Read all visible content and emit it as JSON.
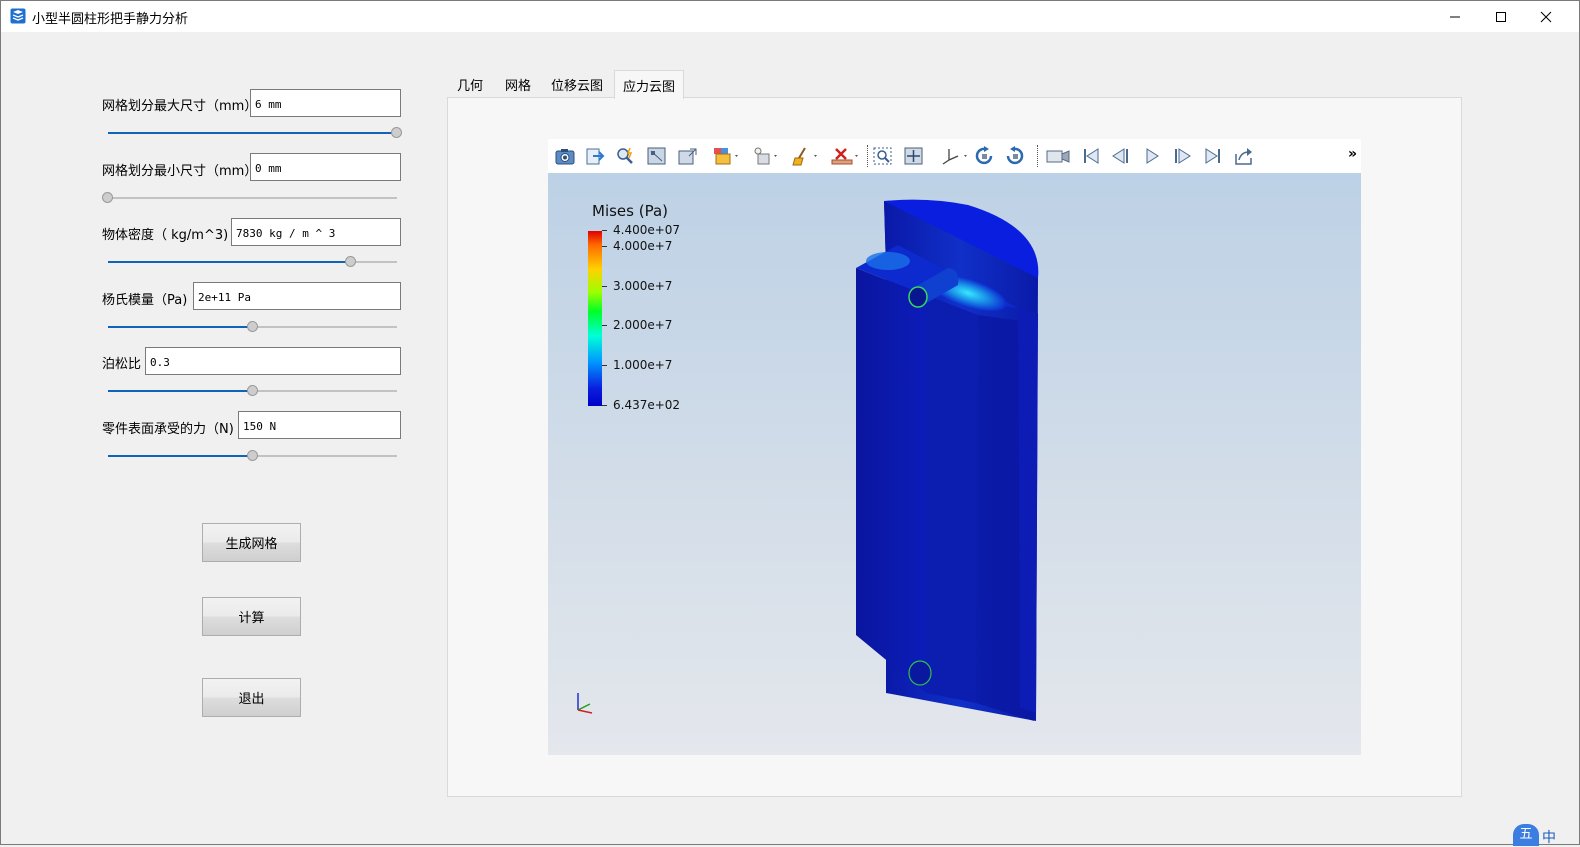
{
  "window": {
    "title": "小型半圆柱形把手静力分析",
    "minimize": "—",
    "maximize": "☐",
    "close": "✕"
  },
  "params": [
    {
      "label": "网格划分最大尺寸（mm）",
      "value": "6 mm",
      "slider": 1.0
    },
    {
      "label": "网格划分最小尺寸（mm）",
      "value": "0 mm",
      "slider": 0.0
    },
    {
      "label": "物体密度（ kg/m^3)",
      "value": "7830 kg / m ^ 3",
      "slider": 0.84
    },
    {
      "label": "杨氏模量（Pa)",
      "value": "2e+11 Pa",
      "slider": 0.5
    },
    {
      "label": "泊松比",
      "value": "0.3",
      "slider": 0.5
    },
    {
      "label": "零件表面承受的力（N)",
      "value": "150 N",
      "slider": 0.5
    }
  ],
  "buttons": {
    "mesh": "生成网格",
    "compute": "计算",
    "exit": "退出"
  },
  "tabs": [
    "几何",
    "网格",
    "位移云图",
    "应力云图"
  ],
  "active_tab": "应力云图",
  "viewer": {
    "overflow": "»",
    "legend": {
      "title": "Mises (Pa)",
      "labels": [
        "4.400e+07",
        "4.000e+7",
        "3.000e+7",
        "2.000e+7",
        "1.000e+7",
        "6.437e+02"
      ]
    },
    "axes": {
      "z": "Z",
      "y": "Y",
      "x": "X"
    }
  },
  "ime": {
    "mode": "五",
    "lang": "中"
  },
  "colors": {
    "accent": "#0f63b8",
    "model_blue": "#0a1aa8"
  }
}
